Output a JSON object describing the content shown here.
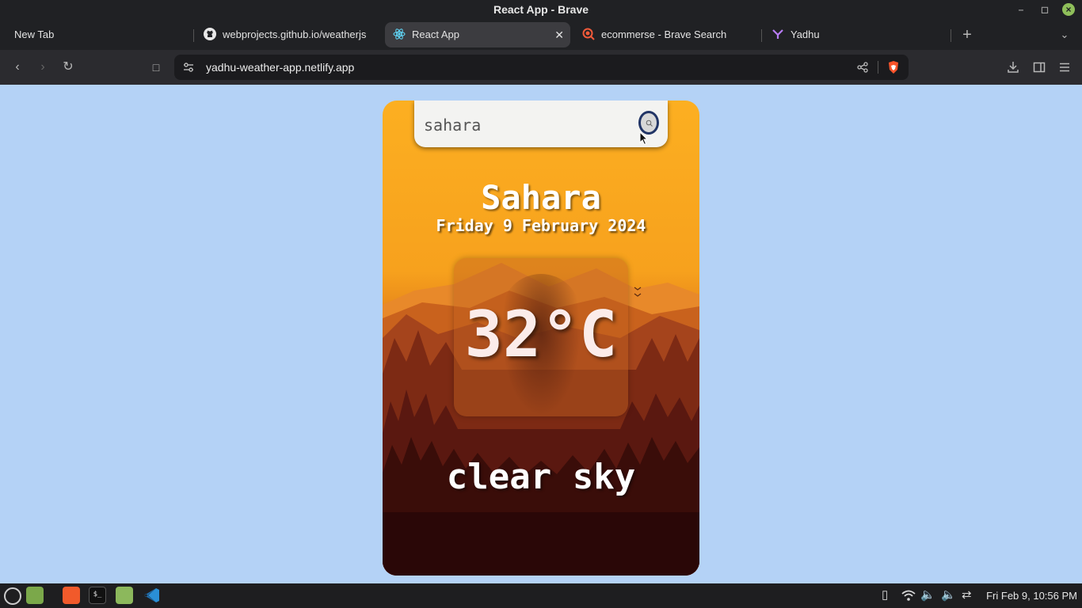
{
  "window": {
    "title": "React App - Brave"
  },
  "tabs": [
    {
      "label": "New Tab",
      "icon": "none"
    },
    {
      "label": "webprojects.github.io/weatherjs",
      "icon": "github-icon"
    },
    {
      "label": "React App",
      "icon": "react-icon",
      "active": true
    },
    {
      "label": "ecommerse - Brave Search",
      "icon": "brave-search-icon"
    },
    {
      "label": "Yadhu",
      "icon": "yadhu-icon"
    }
  ],
  "toolbar": {
    "url": "yadhu-weather-app.netlify.app"
  },
  "weather": {
    "search_value": "sahara",
    "city": "Sahara",
    "date": "Friday 9 February 2024",
    "temperature": "32°C",
    "condition": "clear sky"
  },
  "taskbar": {
    "clock": "Fri Feb  9, 10:56 PM"
  },
  "colors": {
    "page_bg": "#b4d2f6",
    "card_top": "#fcaf21",
    "card_bottom": "#2a0707",
    "search_ring": "#223566"
  }
}
